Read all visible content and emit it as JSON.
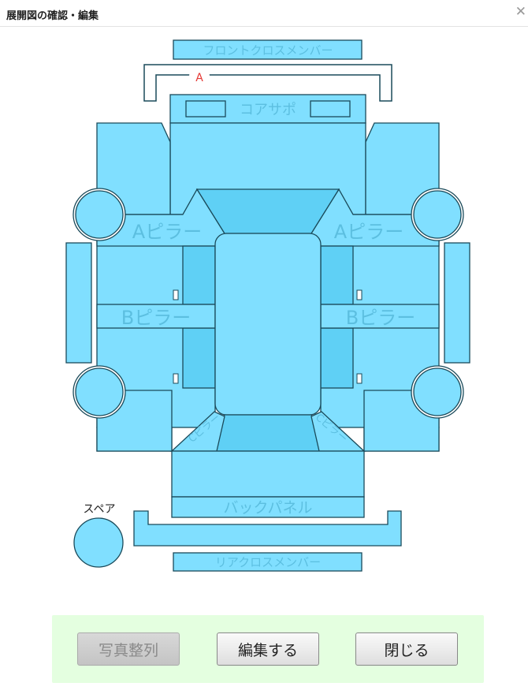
{
  "dialog": {
    "title": "展開図の確認・編集",
    "close_glyph": "✕"
  },
  "parts": {
    "front_cross_member": "フロントクロスメンバー",
    "core_support": "コアサポ",
    "a_pillar_left": "Aピラー",
    "a_pillar_right": "Aピラー",
    "b_pillar_left": "Bピラー",
    "b_pillar_right": "Bピラー",
    "c_pillar_left": "Cピラー",
    "c_pillar_right": "Cピラー",
    "back_panel": "バックパネル",
    "rear_cross_member": "リアクロスメンバー",
    "spare": "スペア"
  },
  "damage_markers": [
    {
      "code": "A",
      "part": "front_cross_member"
    }
  ],
  "footer": {
    "buttons": [
      {
        "label": "写真整列",
        "enabled": false
      },
      {
        "label": "編集する",
        "enabled": true
      },
      {
        "label": "閉じる",
        "enabled": true
      }
    ]
  },
  "colors": {
    "panel_fill": "#80dfff",
    "panel_dark": "#5fd0f5",
    "outline": "#1a4a5a",
    "label": "#5cbfe0",
    "marker": "#e53935",
    "footer_bg": "#e4ffe0"
  }
}
